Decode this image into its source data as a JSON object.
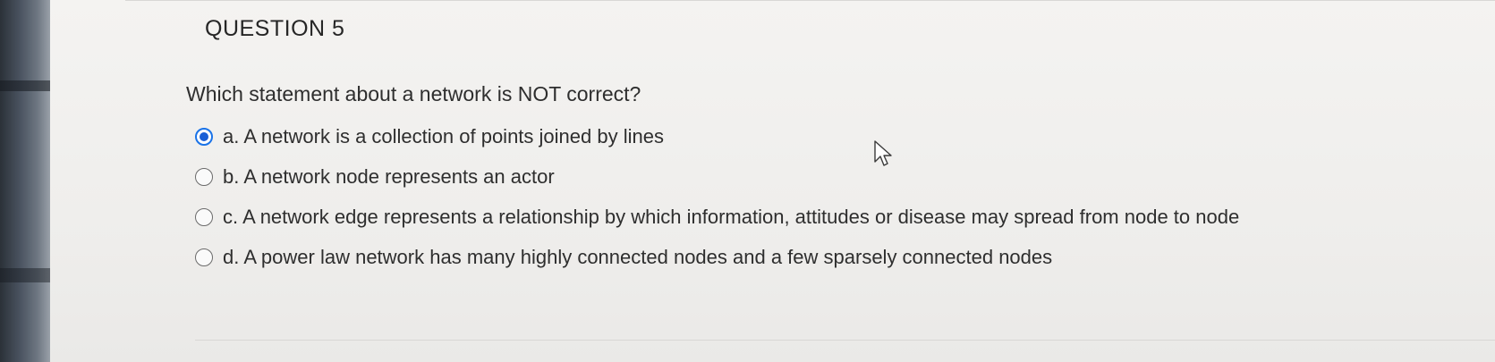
{
  "question": {
    "title": "QUESTION 5",
    "prompt": "Which statement about a network is NOT correct?"
  },
  "options": [
    {
      "letter": "a.",
      "text": "A network is a collection of points joined by lines",
      "selected": true
    },
    {
      "letter": "b.",
      "text": "A network node represents an actor",
      "selected": false
    },
    {
      "letter": "c.",
      "text": "A network edge represents a relationship by which information, attitudes or disease may spread from node to node",
      "selected": false
    },
    {
      "letter": "d.",
      "text": "A power law network has many highly connected nodes and a few sparsely connected nodes",
      "selected": false
    }
  ],
  "colors": {
    "radio_selected": "#1a5fd6",
    "text": "#2e2e2e"
  },
  "icons": {
    "pointer": "mouse-pointer-icon"
  }
}
